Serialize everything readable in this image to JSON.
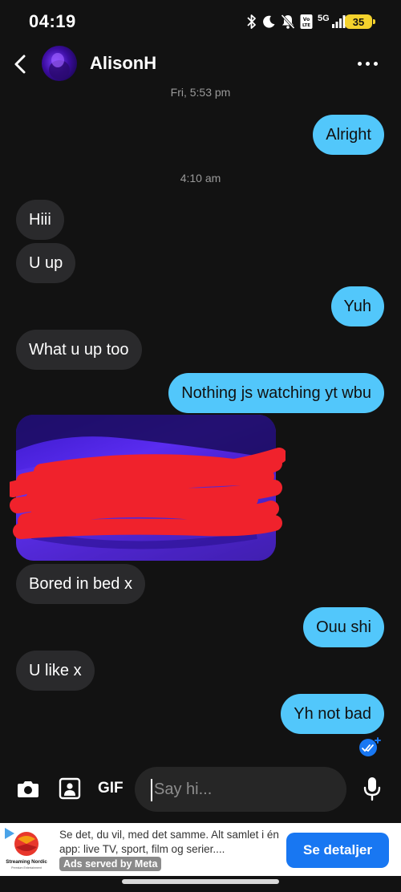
{
  "status_bar": {
    "time": "04:19",
    "network": "5G",
    "battery": "35"
  },
  "header": {
    "contact_name": "AlisonH"
  },
  "messages": [
    {
      "kind": "timestamp",
      "text": "Fri, 5:53 pm"
    },
    {
      "kind": "outgoing",
      "text": "Alright"
    },
    {
      "kind": "timestamp",
      "text": "4:10 am"
    },
    {
      "kind": "incoming",
      "text": "Hiii"
    },
    {
      "kind": "incoming",
      "text": "U up"
    },
    {
      "kind": "outgoing",
      "text": "Yuh"
    },
    {
      "kind": "incoming",
      "text": "What u up too"
    },
    {
      "kind": "outgoing",
      "text": "Nothing js watching yt wbu"
    },
    {
      "kind": "incoming-media",
      "text": ""
    },
    {
      "kind": "incoming",
      "text": "Bored in bed x"
    },
    {
      "kind": "outgoing",
      "text": "Ouu shi"
    },
    {
      "kind": "incoming",
      "text": "U like x"
    },
    {
      "kind": "outgoing",
      "text": "Yh not bad"
    }
  ],
  "composer": {
    "gif_label": "GIF",
    "placeholder": "Say hi..."
  },
  "ad": {
    "brand": "Streaming Nordic",
    "brand_sub": "Premium Entertainment",
    "text": "Se det, du vil, med det samme. Alt samlet i én app: live TV, sport, film og serier....",
    "badge": "Ads served by Meta",
    "cta": "Se detaljer"
  },
  "colors": {
    "outgoing_bubble": "#52c7fb",
    "incoming_bubble": "#2a2a2c",
    "background": "#121212",
    "cta": "#1877f2"
  }
}
